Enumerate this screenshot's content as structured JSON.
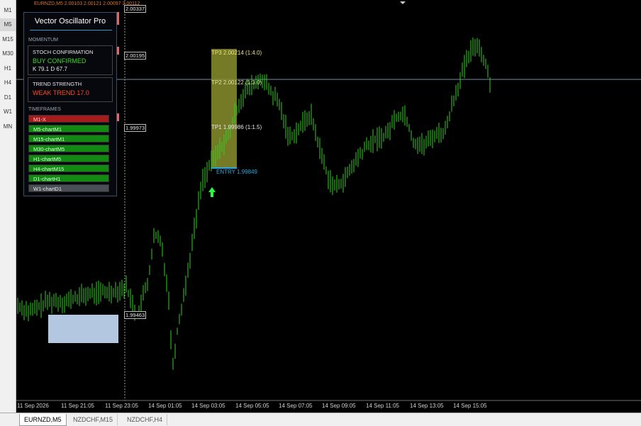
{
  "window": {
    "ticker": "EURNZD,M5  2.00103  2.00121  2.00097  2.00112"
  },
  "timeframes": [
    "M1",
    "M5",
    "M15",
    "M30",
    "H1",
    "H4",
    "D1",
    "W1",
    "MN"
  ],
  "active_timeframe": "M5",
  "tabs": [
    {
      "label": "EURNZD,M5",
      "active": true
    },
    {
      "label": "NZDCHF,M15",
      "active": false
    },
    {
      "label": "NZDCHF,H4",
      "active": false
    }
  ],
  "panel": {
    "title": "Vector Oscillator Pro",
    "momentum_label": "MOMENTUM",
    "stoch_title": "STOCH CONFIRMATION",
    "stoch_signal": "BUY   CONFIRMED",
    "stoch_values": "K 79.1   D 67.7",
    "trend_title": "TREND STRENGTH",
    "trend_value": "WEAK TREND   17.0",
    "timeframes_label": "TIMEFRAMES",
    "tf_rows": [
      {
        "label": "M1-X",
        "state": "red"
      },
      {
        "label": "M5-chartM1",
        "state": "green"
      },
      {
        "label": "M15-chartM1",
        "state": "green"
      },
      {
        "label": "M30-chartM5",
        "state": "green"
      },
      {
        "label": "H1-chartM5",
        "state": "green"
      },
      {
        "label": "H4-chartM15",
        "state": "green"
      },
      {
        "label": "D1-chartH1",
        "state": "green"
      },
      {
        "label": "W1-chartD1",
        "state": "gray"
      }
    ]
  },
  "price_levels": {
    "top": "2.00337",
    "upper": "2.00195",
    "middle": "1.99973",
    "lower": "1.99463"
  },
  "targets": {
    "tp3": "TP3 2.00214 (1:4.0)",
    "tp2": "TP2 2.00122 (1:3.0)",
    "tp1": "TP1 1.99986 (1:1.5)",
    "entry": "ENTRY 1.99849"
  },
  "x_ticks": [
    "11 Sep 2026",
    "11 Sep 21:05",
    "11 Sep 23:05",
    "14 Sep 01:05",
    "14 Sep 03:05",
    "14 Sep 05:05",
    "14 Sep 07:05",
    "14 Sep 09:05",
    "14 Sep 11:05",
    "14 Sep 13:05",
    "14 Sep 15:05"
  ],
  "colors": {
    "candle": "#2fd11f",
    "target_zone": "#8a8f2e",
    "support_zone": "#b4c7e0",
    "entry_line": "#2aa7e0",
    "arrow": "#1fff3a",
    "hline": "#6d8fa8"
  }
}
